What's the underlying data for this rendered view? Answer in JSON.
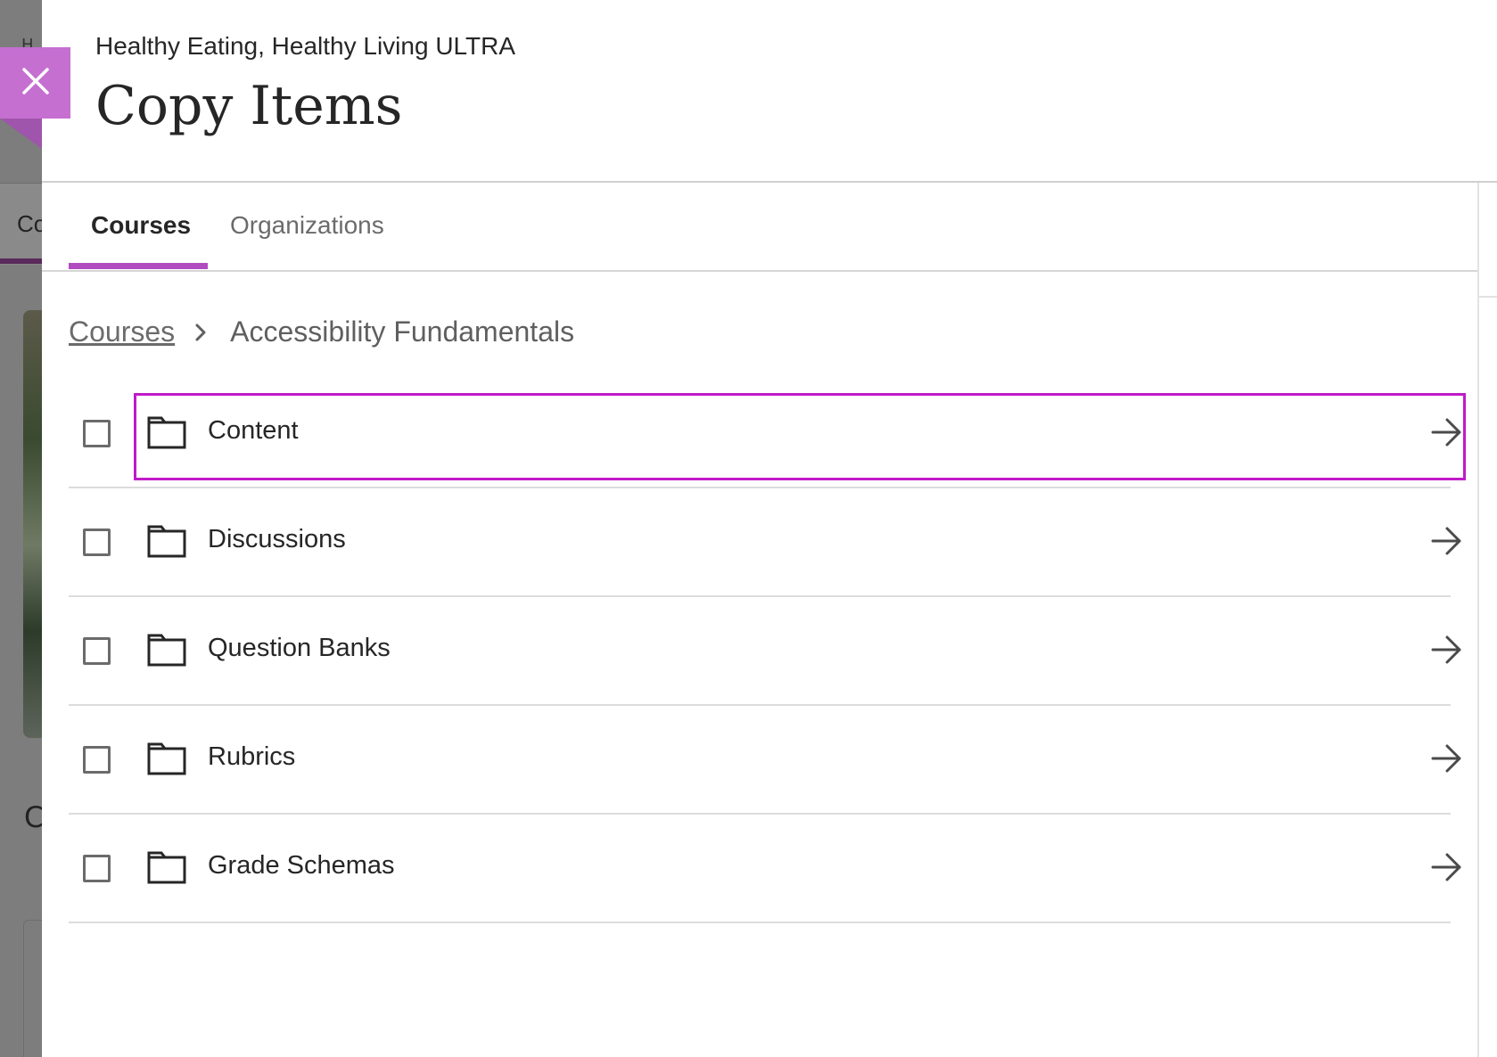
{
  "header": {
    "course_name": "Healthy Eating, Healthy Living ULTRA",
    "title": "Copy Items"
  },
  "close_button": {
    "label": "Close"
  },
  "tabs": [
    {
      "label": "Courses",
      "selected": true
    },
    {
      "label": "Organizations",
      "selected": false
    }
  ],
  "breadcrumb": {
    "root": "Courses",
    "current": "Accessibility Fundamentals"
  },
  "items": [
    {
      "label": "Content",
      "icon": "folder-icon",
      "checked": false,
      "focused": true
    },
    {
      "label": "Discussions",
      "icon": "folder-icon",
      "checked": false,
      "focused": false
    },
    {
      "label": "Question Banks",
      "icon": "folder-icon",
      "checked": false,
      "focused": false
    },
    {
      "label": "Rubrics",
      "icon": "folder-icon",
      "checked": false,
      "focused": false
    },
    {
      "label": "Grade Schemas",
      "icon": "folder-icon",
      "checked": false,
      "focused": false
    }
  ],
  "background": {
    "tab_fragment": "Co",
    "heading_fragment": "C",
    "top_fragment": "H"
  },
  "colors": {
    "accent": "#b04cc0",
    "close_bg": "#c56fd1",
    "focus_ring": "#c01ac9",
    "text": "#262626"
  }
}
